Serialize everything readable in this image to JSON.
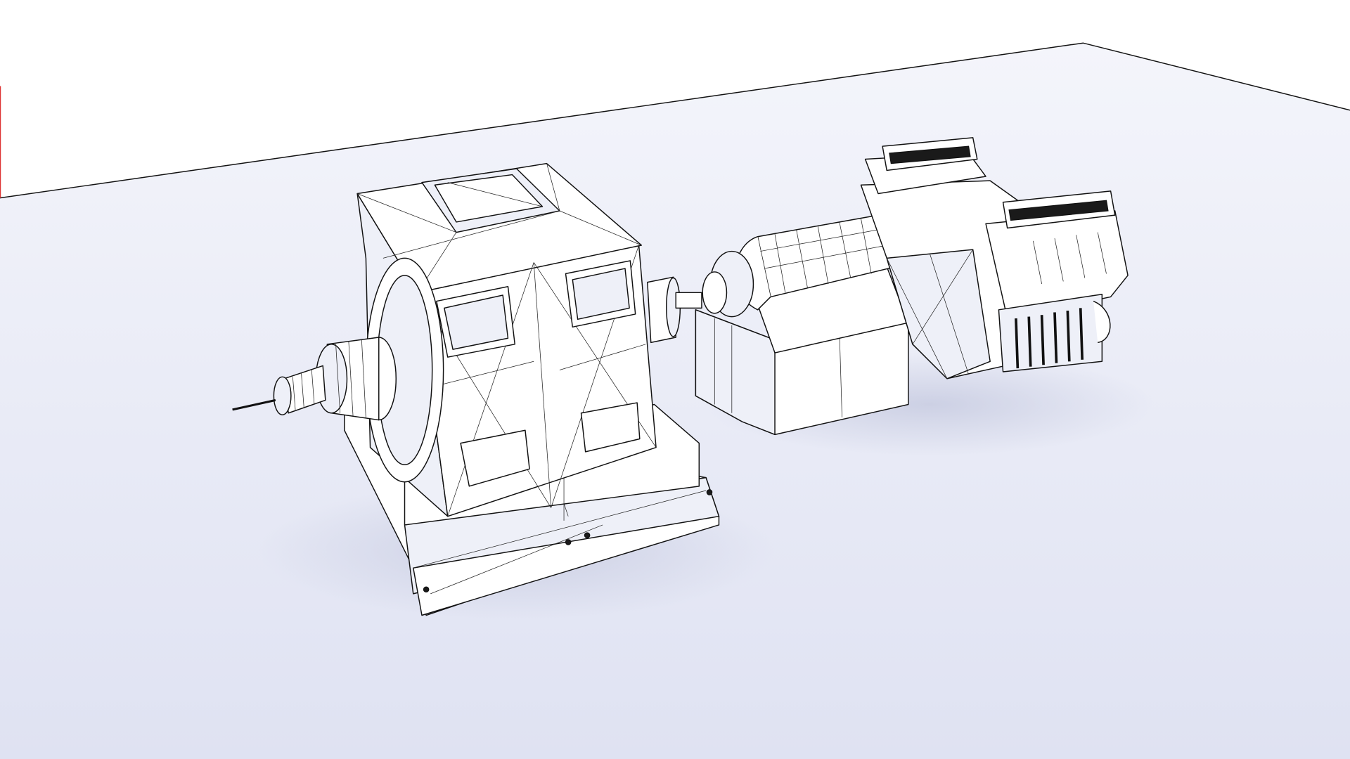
{
  "colors": {
    "background": "#ffffff",
    "ground": "#e3e6f4",
    "model_fill": "#ffffff",
    "wire": "#111111"
  }
}
